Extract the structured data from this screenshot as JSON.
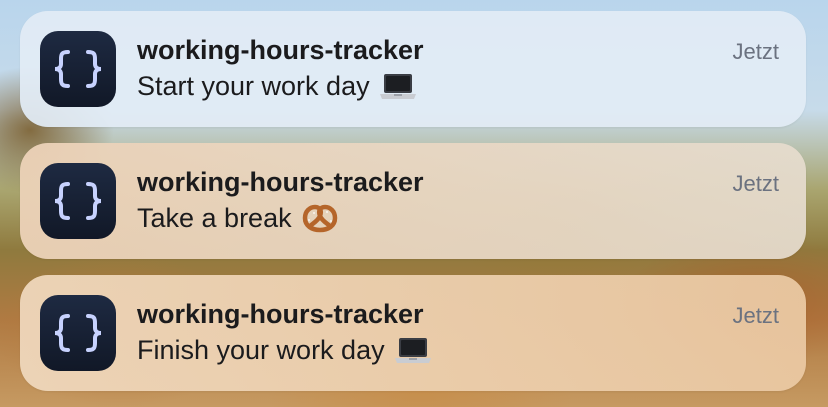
{
  "notifications": [
    {
      "app_name": "working-hours-tracker",
      "message": "Start your work day",
      "time": "Jetzt",
      "emoji_icon": "laptop-icon"
    },
    {
      "app_name": "working-hours-tracker",
      "message": "Take a break",
      "time": "Jetzt",
      "emoji_icon": "pretzel-icon"
    },
    {
      "app_name": "working-hours-tracker",
      "message": "Finish your work day",
      "time": "Jetzt",
      "emoji_icon": "laptop-icon"
    }
  ],
  "app_icon": {
    "name": "curly-braces-icon",
    "background": "#111827",
    "glyph_color": "#c7d2fe"
  }
}
